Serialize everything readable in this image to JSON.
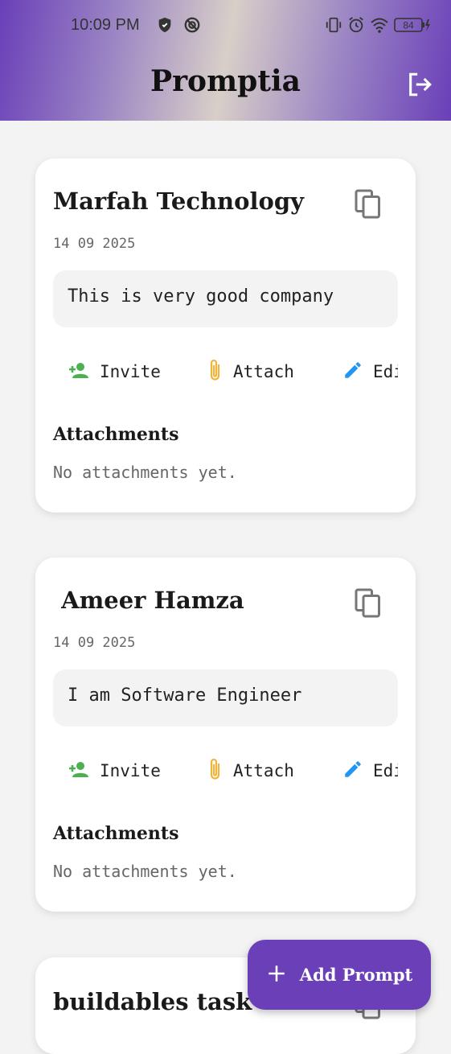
{
  "status_bar": {
    "time": "10:09 PM",
    "battery": "84"
  },
  "app": {
    "title": "Promptia"
  },
  "prompts": [
    {
      "title": "Marfah Technology",
      "date": "14 09 2025",
      "description": "This is very good company"
    },
    {
      "title": " Ameer Hamza",
      "date": "14 09 2025",
      "description": "I am Software Engineer"
    },
    {
      "title": "buildables task"
    }
  ],
  "actions": {
    "invite": "Invite",
    "attach": "Attach",
    "edit": "Edit"
  },
  "attachments": {
    "heading": "Attachments",
    "empty": "No attachments yet."
  },
  "fab": {
    "label": "Add Prompt"
  },
  "colors": {
    "accent": "#6a3fb8",
    "invite_icon": "#4caf50",
    "attach_icon": "#f2b43a",
    "edit_icon": "#2196f3"
  }
}
